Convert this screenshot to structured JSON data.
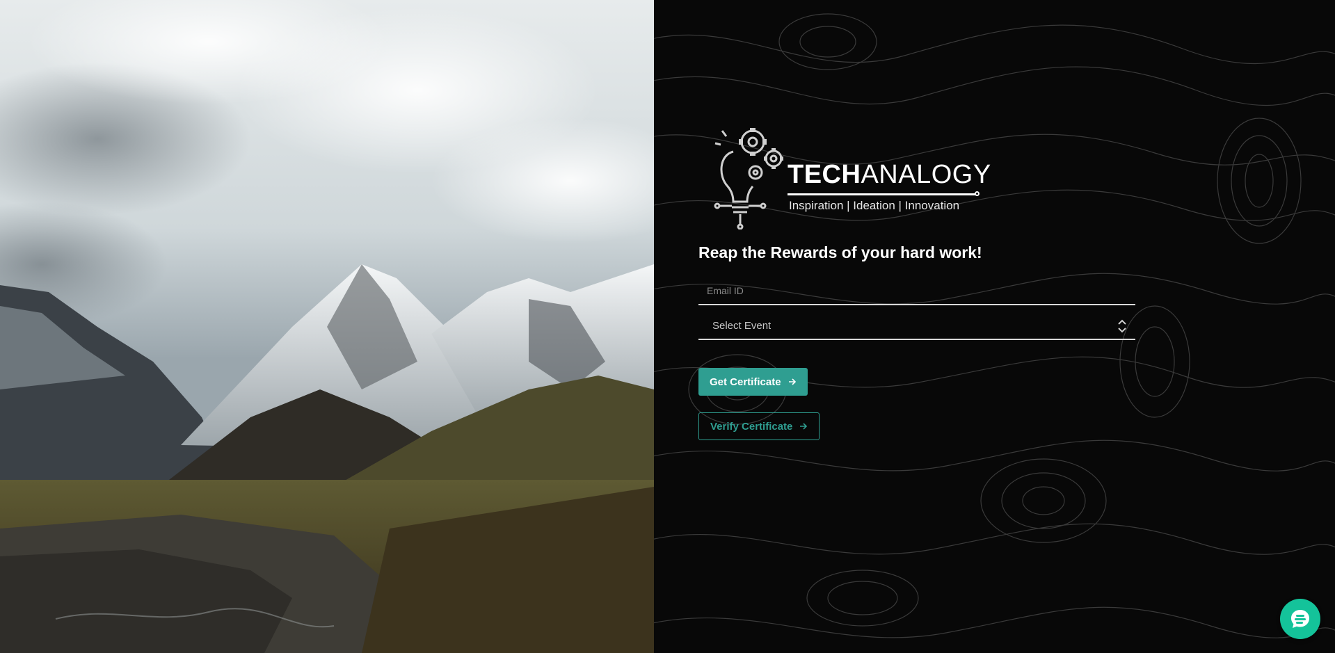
{
  "brand": {
    "name_bold": "TECH",
    "name_light": "ANALOGY",
    "tagline": "Inspiration | Ideation | Innovation"
  },
  "headline": "Reap the Rewards of your hard work!",
  "form": {
    "email_placeholder": "Email ID",
    "email_value": "",
    "event_select_value": "Select Event"
  },
  "buttons": {
    "get_certificate": "Get Certificate",
    "verify_certificate": "Verify Certificate"
  },
  "icons": {
    "logo": "lightbulb-gears-icon",
    "select_caret": "chevron-up-down-icon",
    "button_arrow": "arrow-right-icon",
    "chat": "chat-bubble-icon"
  },
  "colors": {
    "accent": "#2f9e91",
    "chat": "#14c39a",
    "panel_background": "#080808"
  }
}
